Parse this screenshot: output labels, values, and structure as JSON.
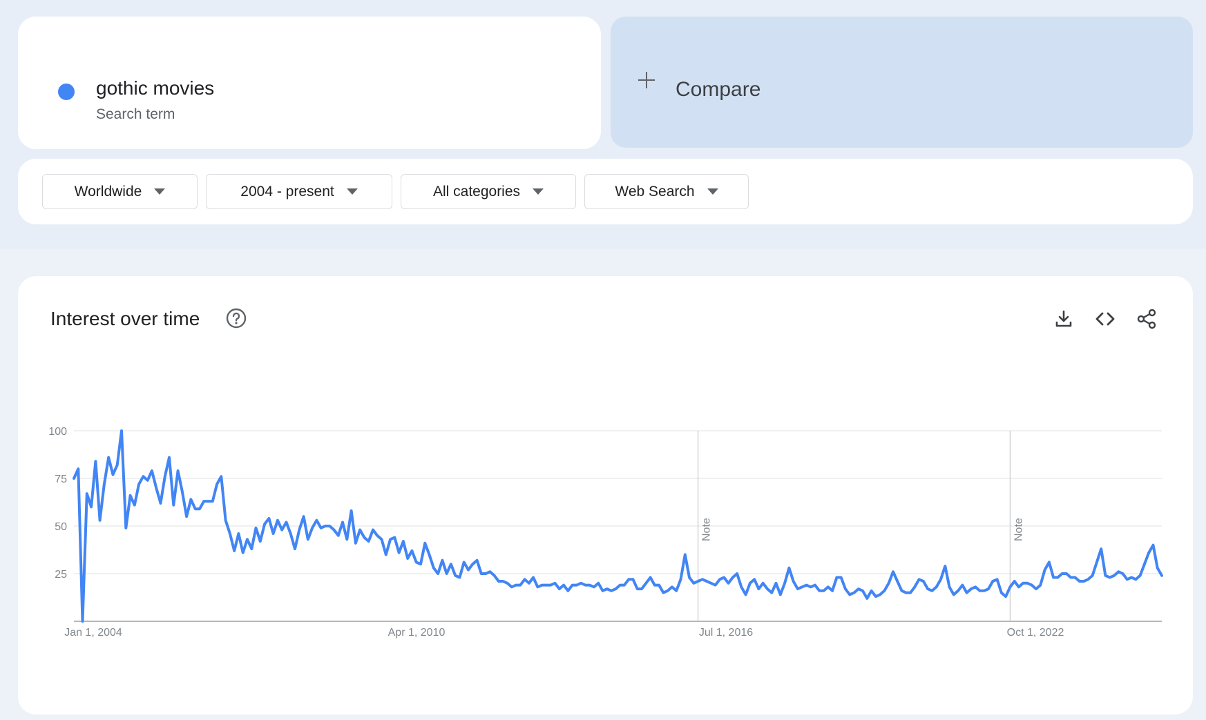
{
  "search_term": {
    "name": "gothic movies",
    "type": "Search term",
    "color": "#4285f4"
  },
  "compare": {
    "label": "Compare",
    "icon": "plus-icon"
  },
  "filters": [
    {
      "label": "Worldwide"
    },
    {
      "label": "2004 - present"
    },
    {
      "label": "All categories"
    },
    {
      "label": "Web Search"
    }
  ],
  "panel": {
    "title": "Interest over time",
    "help_icon": "help-circle-icon",
    "tools": [
      "download-icon",
      "embed-code-icon",
      "share-icon"
    ]
  },
  "chart_data": {
    "type": "line",
    "title": "Interest over time",
    "ylim": [
      0,
      100
    ],
    "yticks": [
      "100",
      "75",
      "50",
      "25"
    ],
    "x_tick_labels": [
      "Jan 1, 2004",
      "Apr 1, 2010",
      "Jul 1, 2016",
      "Oct 1, 2022"
    ],
    "x_range": [
      "2004-01",
      "2024-12"
    ],
    "grid": true,
    "notes": [
      {
        "at": "2016-01",
        "label": "Note"
      },
      {
        "at": "2022-01",
        "label": "Note"
      }
    ],
    "line_color": "#4285f4",
    "series": [
      {
        "start": "2004-01",
        "frequency": "monthly",
        "values": [
          75,
          80,
          0,
          67,
          60,
          84,
          53,
          72,
          86,
          77,
          82,
          100,
          49,
          66,
          61,
          72,
          76,
          74,
          79,
          70,
          62,
          76,
          86,
          61,
          79,
          68,
          55,
          64,
          59,
          59,
          63,
          63,
          63,
          72,
          76,
          53,
          46,
          37,
          46,
          36,
          43,
          38,
          49,
          42,
          51,
          54,
          46,
          53,
          48,
          52,
          46,
          38,
          48,
          55,
          43,
          49,
          53,
          49,
          50,
          50,
          48,
          45,
          52,
          43,
          58,
          41,
          48,
          44,
          42,
          48,
          45,
          43,
          35,
          43,
          44,
          36,
          42,
          33,
          37,
          31,
          30,
          41,
          35,
          28,
          25,
          32,
          25,
          30,
          24,
          23,
          31,
          27,
          30,
          32,
          25,
          25,
          26,
          24,
          21,
          21,
          20,
          18,
          19,
          19,
          22,
          20,
          23,
          18,
          19,
          19,
          19,
          20,
          17,
          19,
          16,
          19,
          19,
          20,
          19,
          19,
          18,
          20,
          16,
          17,
          16,
          17,
          19,
          19,
          22,
          22,
          17,
          17,
          20,
          23,
          19,
          19,
          15,
          16,
          18,
          16,
          22,
          35,
          23,
          20,
          21,
          22,
          21,
          20,
          19,
          22,
          23,
          20,
          23,
          25,
          18,
          14,
          20,
          22,
          17,
          20,
          17,
          15,
          20,
          14,
          20,
          28,
          21,
          17,
          18,
          19,
          18,
          19,
          16,
          16,
          18,
          16,
          23,
          23,
          17,
          14,
          15,
          17,
          16,
          12,
          16,
          13,
          14,
          16,
          20,
          26,
          21,
          16,
          15,
          15,
          18,
          22,
          21,
          17,
          16,
          18,
          22,
          29,
          18,
          14,
          16,
          19,
          15,
          17,
          18,
          16,
          16,
          17,
          21,
          22,
          15,
          13,
          18,
          21,
          18,
          20,
          20,
          19,
          17,
          19,
          27,
          31,
          23,
          23,
          25,
          25,
          23,
          23,
          21,
          21,
          22,
          24,
          31,
          38,
          24,
          23,
          24,
          26,
          25,
          22,
          23,
          22,
          24,
          30,
          36,
          40,
          28,
          24
        ]
      }
    ]
  }
}
